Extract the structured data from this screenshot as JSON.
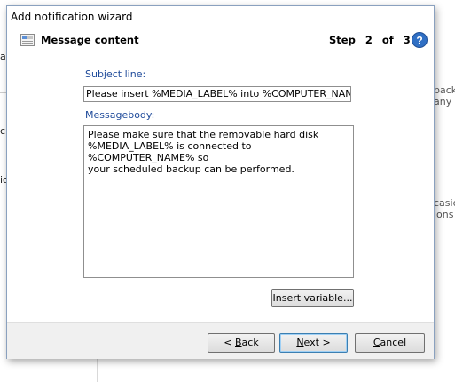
{
  "background": {
    "left_fragments": [
      "at",
      "ci",
      "io"
    ],
    "right_fragments": [
      "back",
      "any e",
      "casic",
      "ions"
    ]
  },
  "dialog": {
    "title": "Add notification wizard",
    "header": {
      "icon": "message-content-icon",
      "title": "Message content",
      "step_word": "Step",
      "step_current": "2",
      "step_of": "of",
      "step_total": "3",
      "help_icon": "help-icon"
    },
    "subject": {
      "label": "Subject line:",
      "value": "Please insert %MEDIA_LABEL% into %COMPUTER_NAME%"
    },
    "body": {
      "label": "Messagebody:",
      "value": "Please make sure that the removable hard disk\n%MEDIA_LABEL% is connected to %COMPUTER_NAME% so\nyour scheduled backup can be performed."
    },
    "insert_variable_label": "Insert variable...",
    "buttons": {
      "back": {
        "prefix": "< ",
        "mnemonic": "B",
        "rest": "ack"
      },
      "next": {
        "mnemonic": "N",
        "rest": "ext >"
      },
      "cancel": {
        "mnemonic": "C",
        "rest": "ancel"
      }
    },
    "colors": {
      "label_blue": "#1e4a9a",
      "help_blue": "#2f6fc4",
      "default_button_border": "#3c7fb1"
    }
  }
}
